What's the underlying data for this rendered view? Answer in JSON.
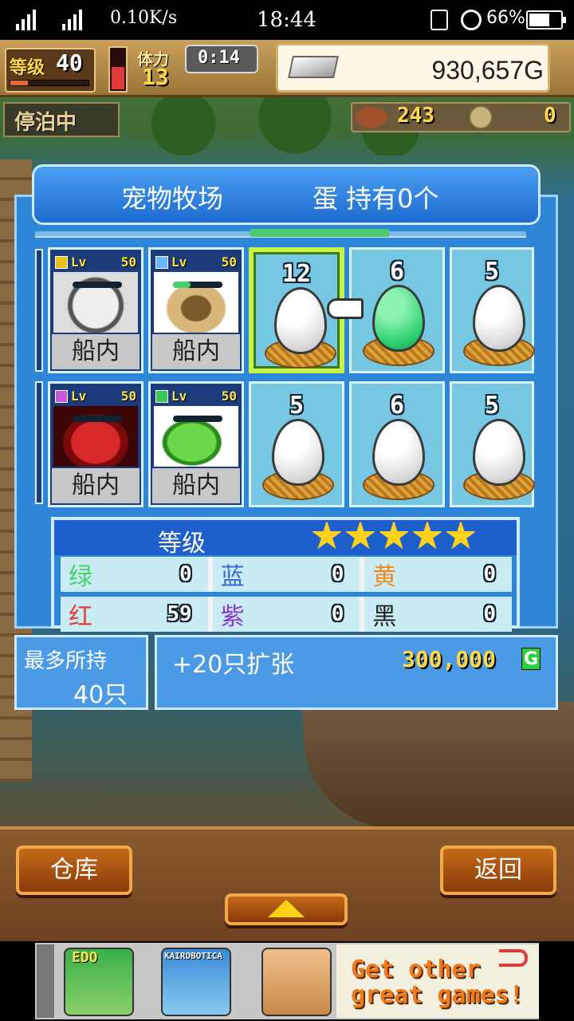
{
  "status_bar": {
    "speed": "0.10K/s",
    "time": "18:44",
    "battery": "66%",
    "battery_level": 0.66
  },
  "hud": {
    "level_label": "等级",
    "level_value": "40",
    "stamina_label": "体力",
    "stamina_value": "13",
    "timer": "0:14",
    "gold": "930,657G",
    "moored_label": "停泊中",
    "food_value": "243",
    "medal_value": "0"
  },
  "panel": {
    "title": "宠物牧场",
    "eggs_held": "蛋 持有0个"
  },
  "pets": [
    {
      "lv": "50",
      "place": "船内",
      "gem": "#e8c21a",
      "hp": 0.0
    },
    {
      "lv": "50",
      "place": "船内",
      "gem": "#6ab6ff",
      "hp": 0.35
    },
    {
      "lv": "50",
      "place": "船内",
      "gem": "#c65ad8",
      "hp": 0.0
    },
    {
      "lv": "50",
      "place": "船内",
      "gem": "#3ac85a",
      "hp": 0.0
    }
  ],
  "pet_lv_label": "Lv",
  "eggs": [
    {
      "count": "12",
      "color": "white",
      "selected": true
    },
    {
      "count": "6",
      "color": "green",
      "selected": false
    },
    {
      "count": "5",
      "color": "white",
      "selected": false
    },
    {
      "count": "5",
      "color": "white",
      "selected": false
    },
    {
      "count": "6",
      "color": "white",
      "selected": false
    },
    {
      "count": "5",
      "color": "white",
      "selected": false
    }
  ],
  "stats": {
    "title": "等级",
    "stars": 5,
    "rows": [
      [
        {
          "label": "绿",
          "value": "0",
          "color": "#4ad06a"
        },
        {
          "label": "蓝",
          "value": "0",
          "color": "#3a6ad8"
        },
        {
          "label": "黄",
          "value": "0",
          "color": "#f08a1a"
        }
      ],
      [
        {
          "label": "红",
          "value": "59",
          "color": "#e83a3a"
        },
        {
          "label": "紫",
          "value": "0",
          "color": "#8a3ad0"
        },
        {
          "label": "黑",
          "value": "0",
          "color": "#222222"
        }
      ]
    ]
  },
  "capacity": {
    "label": "最多所持",
    "value": "40只"
  },
  "expand": {
    "label": "+20只扩张",
    "price": "300,000",
    "currency": "G"
  },
  "buttons": {
    "warehouse": "仓库",
    "back": "返回"
  },
  "ad": {
    "edo_label": "EDO",
    "kairo_label": "KAIROBOTICA",
    "cta_line1": "Get other",
    "cta_line2": "great games!"
  }
}
